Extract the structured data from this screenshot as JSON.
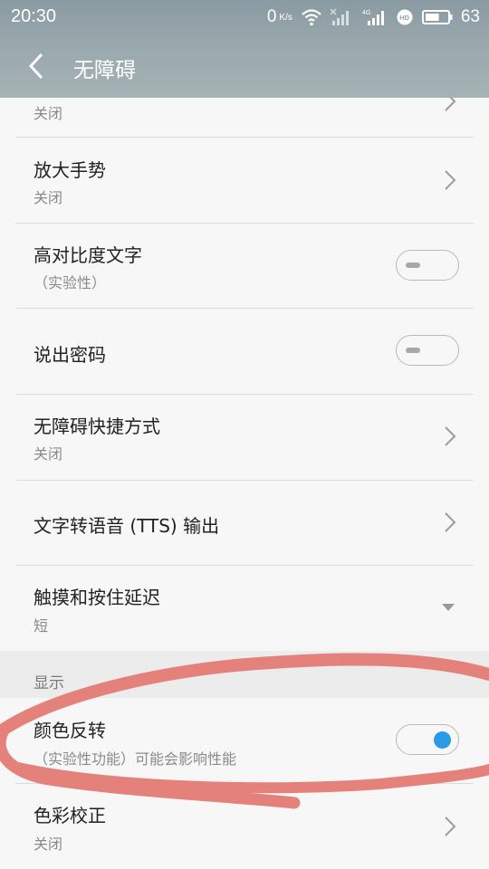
{
  "status_bar": {
    "time": "20:30",
    "net_speed": "0",
    "net_speed_unit": "K/s",
    "battery_percent": "63"
  },
  "app_bar": {
    "title": "无障碍"
  },
  "items": [
    {
      "label": "",
      "sub": "关闭",
      "control": "chevron"
    },
    {
      "label": "放大手势",
      "sub": "关闭",
      "control": "chevron"
    },
    {
      "label": "高对比度文字",
      "sub": "（实验性）",
      "control": "toggle",
      "on": false
    },
    {
      "label": "说出密码",
      "sub": "",
      "control": "toggle",
      "on": false
    },
    {
      "label": "无障碍快捷方式",
      "sub": "关闭",
      "control": "chevron"
    },
    {
      "label": "文字转语音 (TTS) 输出",
      "sub": "",
      "control": "chevron"
    },
    {
      "label": "触摸和按住延迟",
      "sub": "短",
      "control": "dropdown"
    }
  ],
  "section_display": {
    "label": "显示"
  },
  "display_items": [
    {
      "label": "颜色反转",
      "sub": "（实验性功能）可能会影响性能",
      "control": "toggle",
      "on": true
    },
    {
      "label": "色彩校正",
      "sub": "关闭",
      "control": "chevron"
    }
  ],
  "colors": {
    "accent": "#2a9ae6",
    "annotation": "#e5817b"
  }
}
